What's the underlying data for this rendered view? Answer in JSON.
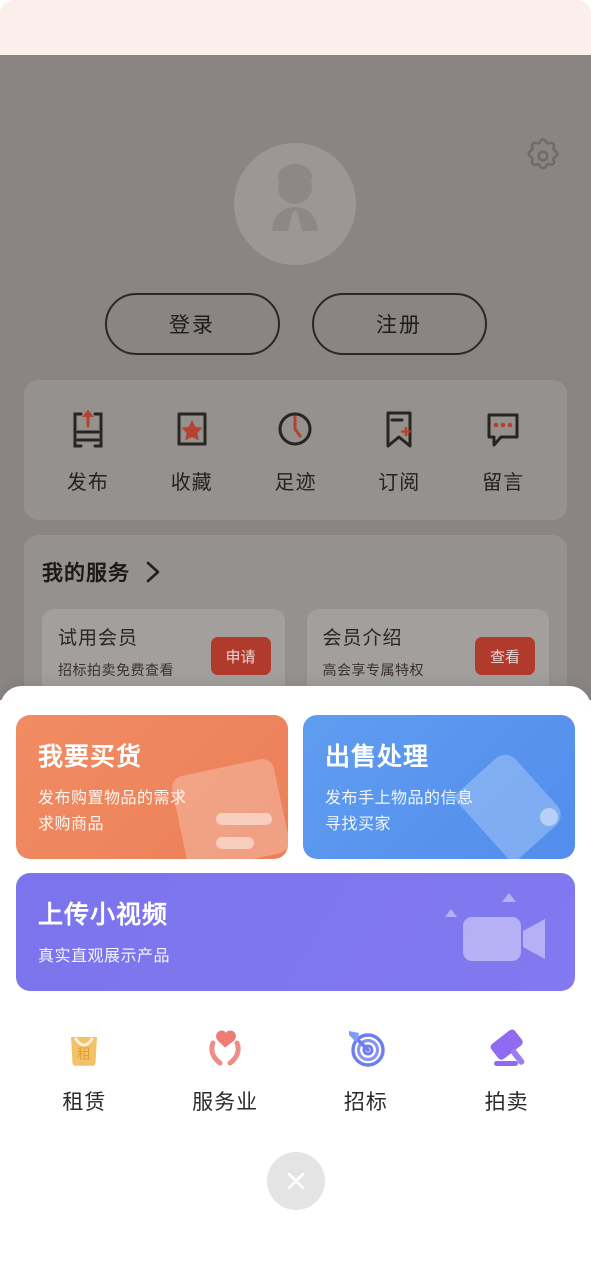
{
  "profile": {
    "settings_icon": "gear-icon",
    "avatar_icon": "default-user-avatar",
    "login_label": "登录",
    "register_label": "注册",
    "quick_actions": [
      {
        "label": "发布",
        "icon": "upload-publish-icon"
      },
      {
        "label": "收藏",
        "icon": "star-favorite-icon"
      },
      {
        "label": "足迹",
        "icon": "clock-history-icon"
      },
      {
        "label": "订阅",
        "icon": "bookmark-subscribe-icon"
      },
      {
        "label": "留言",
        "icon": "message-bubble-icon"
      }
    ],
    "service_section": {
      "title": "我的服务",
      "arrow_icon": "chevron-right-icon",
      "cards": [
        {
          "name": "试用会员",
          "sub": "招标拍卖免费查看",
          "button": "申请"
        },
        {
          "name": "会员介绍",
          "sub": "高会享专属特权",
          "button": "查看"
        }
      ]
    }
  },
  "sheet": {
    "big_cards": [
      {
        "title": "我要买货",
        "sub_line1": "发布购置物品的需求",
        "sub_line2": "求购商品",
        "color": "#ec7f59",
        "art_icon": "document-list-icon"
      },
      {
        "title": "出售处理",
        "sub_line1": "发布手上物品的信息",
        "sub_line2": "寻找买家",
        "color": "#528ded",
        "art_icon": "price-tag-icon"
      }
    ],
    "video_card": {
      "title": "上传小视频",
      "sub": "真实直观展示产品",
      "color": "#7b74ec",
      "art_icon": "video-camera-upload-icon"
    },
    "categories": [
      {
        "label": "租赁",
        "icon": "rental-bag-icon",
        "glyph": "租",
        "color": "#f2b752"
      },
      {
        "label": "服务业",
        "icon": "heart-hands-service-icon",
        "color": "#ef7b77"
      },
      {
        "label": "招标",
        "icon": "target-dart-bidding-icon",
        "color": "#6c7ef0"
      },
      {
        "label": "拍卖",
        "icon": "gavel-auction-icon",
        "color": "#8e6bf0"
      }
    ],
    "close_label": "×",
    "close_icon": "close-x-icon"
  }
}
